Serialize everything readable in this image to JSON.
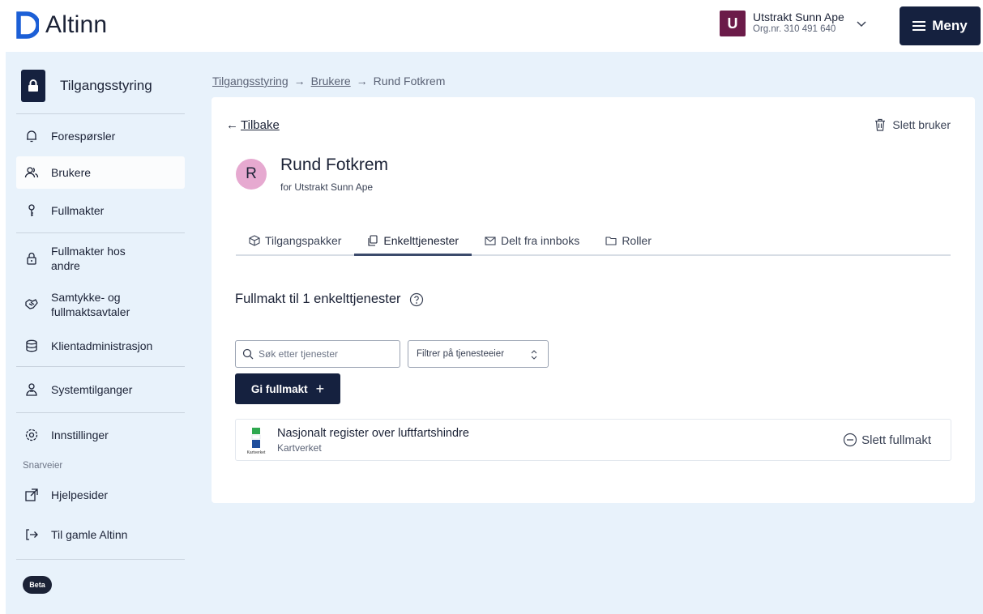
{
  "header": {
    "logo_text": "Altinn",
    "org_avatar_letter": "U",
    "org_name": "Utstrakt Sunn Ape",
    "org_nr": "Org.nr. 310 491 640",
    "menu_label": "Meny"
  },
  "sidebar": {
    "head_label": "Tilgangsstyring",
    "items": [
      {
        "label": "Forespørsler",
        "icon": "bell-icon"
      },
      {
        "label": "Brukere",
        "icon": "users-icon",
        "active": true
      },
      {
        "label": "Fullmakter",
        "icon": "key-icon"
      },
      {
        "label": "Fullmakter hos andre",
        "icon": "padlock-icon"
      },
      {
        "label": "Samtykke- og fullmaktsavtaler",
        "icon": "handshake-icon"
      },
      {
        "label": "Klientadministrasjon",
        "icon": "database-icon"
      },
      {
        "label": "Systemtilganger",
        "icon": "person-system-icon"
      },
      {
        "label": "Innstillinger",
        "icon": "gear-icon"
      },
      {
        "label": "Hjelpesider",
        "icon": "external-link-icon"
      },
      {
        "label": "Til gamle Altinn",
        "icon": "enter-icon"
      }
    ],
    "shortcuts_label": "Snarveier",
    "beta_label": "Beta"
  },
  "breadcrumb": {
    "items": [
      "Tilgangsstyring",
      "Brukere"
    ],
    "current": "Rund Fotkrem"
  },
  "card": {
    "back_label": "Tilbake",
    "delete_user_label": "Slett bruker",
    "user_avatar_letter": "R",
    "user_name": "Rund Fotkrem",
    "user_sub": "for Utstrakt Sunn Ape",
    "tabs": [
      {
        "label": "Tilgangspakker",
        "icon": "package-icon"
      },
      {
        "label": "Enkelttjenester",
        "icon": "copy-icon",
        "active": true
      },
      {
        "label": "Delt fra innboks",
        "icon": "envelope-icon"
      },
      {
        "label": "Roller",
        "icon": "folder-icon"
      }
    ],
    "section_title": "Fullmakt til 1 enkelttjenester",
    "search_placeholder": "Søk etter tjenester",
    "filter_label": "Filtrer på tjenesteeier",
    "give_button_label": "Gi fullmakt",
    "services": [
      {
        "name": "Nasjonalt register over luftfartshindre",
        "owner": "Kartverket",
        "logo_text": "Kartverket",
        "delete_label": "Slett fullmakt"
      }
    ]
  },
  "colors": {
    "navy": "#15213f",
    "page_bg": "#e8f2fb",
    "org_avatar": "#6b1b49",
    "user_avatar": "#e6a9d0",
    "logo_blue": "#1c5fd6"
  }
}
